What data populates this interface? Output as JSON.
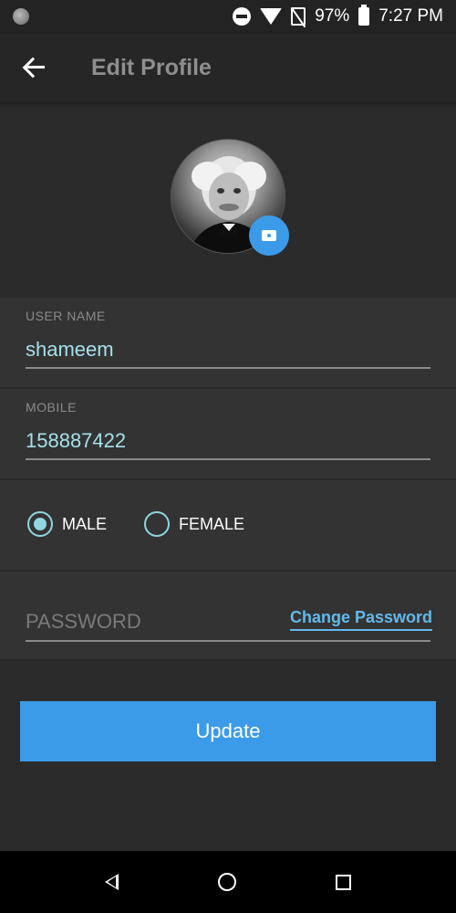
{
  "status_bar": {
    "battery": "97%",
    "time": "7:27 PM",
    "icons": [
      "notification-dot-icon",
      "do-not-disturb-icon",
      "wifi-icon",
      "no-sim-icon",
      "battery-icon"
    ]
  },
  "app_bar": {
    "back_icon": "arrow-back-icon",
    "title": "Edit Profile"
  },
  "profile": {
    "avatar": "profile-photo",
    "camera_icon": "camera-icon"
  },
  "form": {
    "username": {
      "label": "USER NAME",
      "value": "shameem"
    },
    "mobile": {
      "label": "MOBILE",
      "value": "158887422"
    },
    "gender": {
      "options": [
        {
          "label": "MALE",
          "checked": true
        },
        {
          "label": "FEMALE",
          "checked": false
        }
      ]
    },
    "password": {
      "placeholder": "PASSWORD",
      "change_link": "Change Password"
    }
  },
  "actions": {
    "update_label": "Update"
  },
  "nav_bar": {
    "icons": [
      "nav-back-icon",
      "nav-home-icon",
      "nav-recents-icon"
    ]
  },
  "colors": {
    "accent": "#3c9be8",
    "field_text": "#a6e0ea",
    "radio": "#8fd6e0",
    "link": "#62b9ec",
    "background": "#2b2b2b"
  }
}
